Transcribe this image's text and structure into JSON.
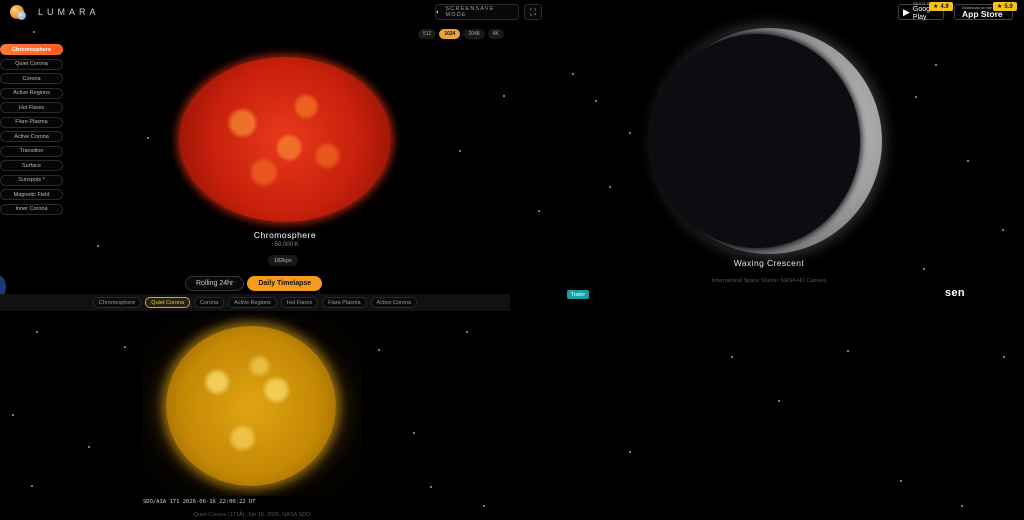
{
  "brand": {
    "name": "LUMARA"
  },
  "header": {
    "screensave_label": "SCREENSAVE MODE",
    "screensave_icon": "moon-icon",
    "fullscreen_icon": "fullscreen-icon",
    "stores": [
      {
        "small": "GET IT ON",
        "big": "Google Play",
        "rating": "4.9",
        "icon": "google-play-icon"
      },
      {
        "small": "Download on the",
        "big": "App Store",
        "rating": "5.0",
        "icon": "apple-icon"
      }
    ]
  },
  "resolution": {
    "options": [
      "512",
      "1024",
      "2048",
      "4K"
    ],
    "selected": "1024"
  },
  "wavelengths": {
    "items": [
      "Chromosphere",
      "Quiet Corona",
      "Corona",
      "Active Regions",
      "Hot Flares",
      "Flare Plasma",
      "Active Corona",
      "Transition",
      "Surface",
      "Sunspots *",
      "Magnetic Field",
      "Inner Corona"
    ],
    "selected": "Chromosphere"
  },
  "primary_view": {
    "title": "Chromosphere",
    "temperature": "~50,000 K",
    "size": "182kpx"
  },
  "modes": {
    "options": [
      "Rolling 24hr",
      "Daily Timelapse"
    ],
    "selected": "Daily Timelapse"
  },
  "secondary_view": {
    "tabs": [
      "Chromosphere",
      "Quiet Corona",
      "Corona",
      "Active Regions",
      "Hot Flares",
      "Flare Plasma",
      "Active Corona"
    ],
    "selected": "Quiet Corona",
    "stamp": "SDO/AIA  171    2026-06-16 22:00:22 UT",
    "caption": "Quiet Corona (171Å), Jun 16, 2026, NASA SDO"
  },
  "moon_view": {
    "phase": "Waxing Crescent",
    "caption": "International Space Station: NASA HD Camera"
  },
  "trailer_label": "Trailer",
  "sen_logo": "sen",
  "colors": {
    "accent_orange": "#f59b1d",
    "chromosphere_active": "#ff5a1a",
    "rating_yellow": "#f7c21a",
    "trailer_teal": "#14a0a8"
  }
}
